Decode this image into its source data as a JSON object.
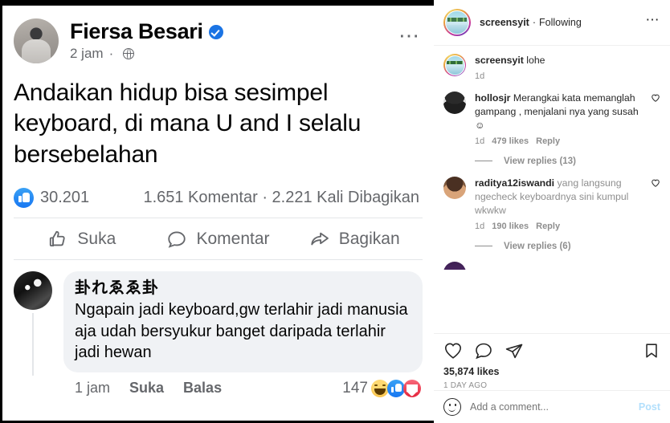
{
  "facebook": {
    "post": {
      "author": "Fiersa Besari",
      "verified": true,
      "time": "2 jam",
      "separator": "·",
      "privacy_icon": "globe-icon",
      "menu_icon": "more-options-icon",
      "body": "Andaikan hidup bisa sesimpel keyboard, di mana U and I selalu bersebelahan"
    },
    "stats": {
      "reaction_icon": "like-reaction-icon",
      "likes": "30.201",
      "comments_shares": "1.651 Komentar · 2.221 Kali Dibagikan"
    },
    "actions": [
      {
        "label": "Suka",
        "icon": "thumbs-up-icon"
      },
      {
        "label": "Komentar",
        "icon": "comment-bubble-icon"
      },
      {
        "label": "Bagikan",
        "icon": "share-arrow-icon"
      }
    ],
    "comment": {
      "author": "卦れゑゑ卦",
      "text": "Ngapain jadi keyboard,gw terlahir jadi manusia aja udah bersyukur banget daripada terlahir jadi hewan",
      "time": "1 jam",
      "like_label": "Suka",
      "reply_label": "Balas",
      "reaction_count": "147",
      "reactions": [
        "haha-emoji",
        "like-emoji",
        "love-emoji"
      ]
    }
  },
  "instagram": {
    "header": {
      "username": "screensyit",
      "separator": "·",
      "follow_state": "Following",
      "menu_icon": "more-options-icon",
      "avatar": "story-ring-avatar"
    },
    "caption": {
      "username": "screensyit",
      "text": "lohe",
      "time": "1d"
    },
    "comments": [
      {
        "username": "hollosjr",
        "text": "Merangkai kata memanglah gampang , menjalani nya yang susah ☺",
        "time": "1d",
        "likes": "479 likes",
        "reply": "Reply",
        "like_icon": "heart-outline-icon",
        "replies_label": "View replies (13)"
      },
      {
        "username": "raditya12iswandi",
        "text": "yang langsung ngecheck keyboardnya sini kumpul wkwkw",
        "time": "1d",
        "likes": "190 likes",
        "reply": "Reply",
        "like_icon": "heart-outline-icon",
        "replies_label": "View replies (6)"
      }
    ],
    "action_bar": {
      "like_icon": "heart-outline-icon",
      "comment_icon": "comment-bubble-icon",
      "share_icon": "paper-plane-icon",
      "save_icon": "bookmark-outline-icon",
      "likes": "35,874 likes",
      "timestamp": "1 DAY AGO"
    },
    "add_comment": {
      "emoji_icon": "smiley-icon",
      "placeholder": "Add a comment...",
      "post_label": "Post"
    }
  },
  "colors": {
    "fb_blue": "#1877f2",
    "fb_text": "#050505",
    "fb_secondary": "#65676b",
    "ig_text": "#262626",
    "ig_secondary": "#8e8e8e",
    "ig_post_blue": "#b2dffc"
  }
}
